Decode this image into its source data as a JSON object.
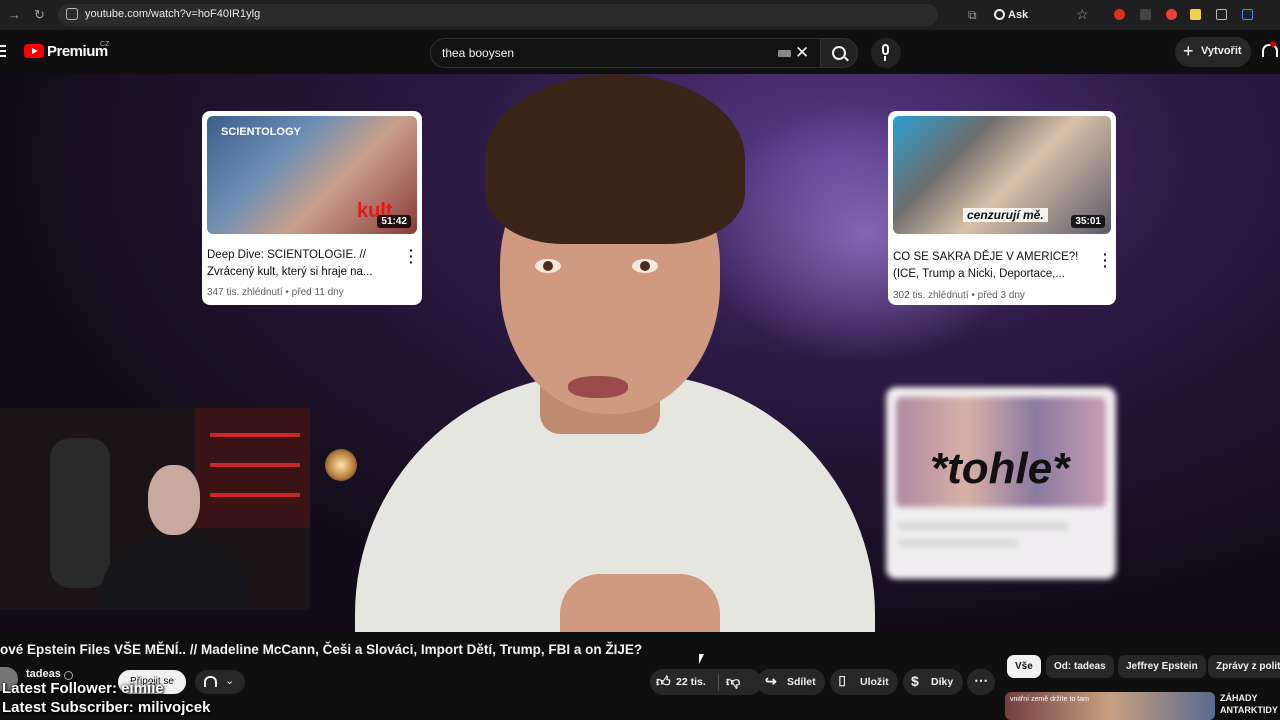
{
  "browser": {
    "url": "youtube.com/watch?v=hoF40IR1ylg",
    "ask_google": "Ask Google"
  },
  "header": {
    "logo_text": "Premium",
    "logo_country": "CZ",
    "search_query": "thea booysen",
    "create_label": "Vytvořit"
  },
  "end_cards": [
    {
      "title": "Deep Dive: SCIENTOLOGIE. // Zvrácený kult, který si hraje na...",
      "views": "347 tis. zhlédnutí",
      "age": "před 11 dny",
      "duration": "51:42",
      "thumb_label": "SCIENTOLOGY",
      "thumb_overlay": "kult"
    },
    {
      "title": "CO SE SAKRA DĚJE V AMERICE?! (ICE, Trump a Nicki, Deportace,...",
      "views": "302 tis. zhlédnutí",
      "age": "před 3 dny",
      "duration": "35:01",
      "thumb_overlay": "cenzurují mě."
    }
  ],
  "blurred_card_caption": "*tohle*",
  "video": {
    "title": "ové Epstein Files VŠE MĚNÍ.. // Madeline McCann, Češi a Slováci, Import Dětí, Trump, FBI a on ŽIJE?",
    "channel": "tadeas",
    "join_label": "Připojit se",
    "likes": "22 tis.",
    "share_label": "Sdílet",
    "save_label": "Uložit",
    "thanks_label": "Díky"
  },
  "chips": [
    "Vše",
    "Od: tadeas",
    "Jeffrey Epstein",
    "Zprávy z politi"
  ],
  "sidebar_preview": {
    "title": "ZÁHADY ANTARKTIDY",
    "thumb_text": "vnitřní země   držíte to tam"
  },
  "stream_overlay": {
    "follower": "Latest Follower: eimiie",
    "subscriber": "Latest Subscriber: milivojcek"
  },
  "colors": {
    "youtube_red": "#ff0000",
    "background": "#0f0f0f"
  }
}
